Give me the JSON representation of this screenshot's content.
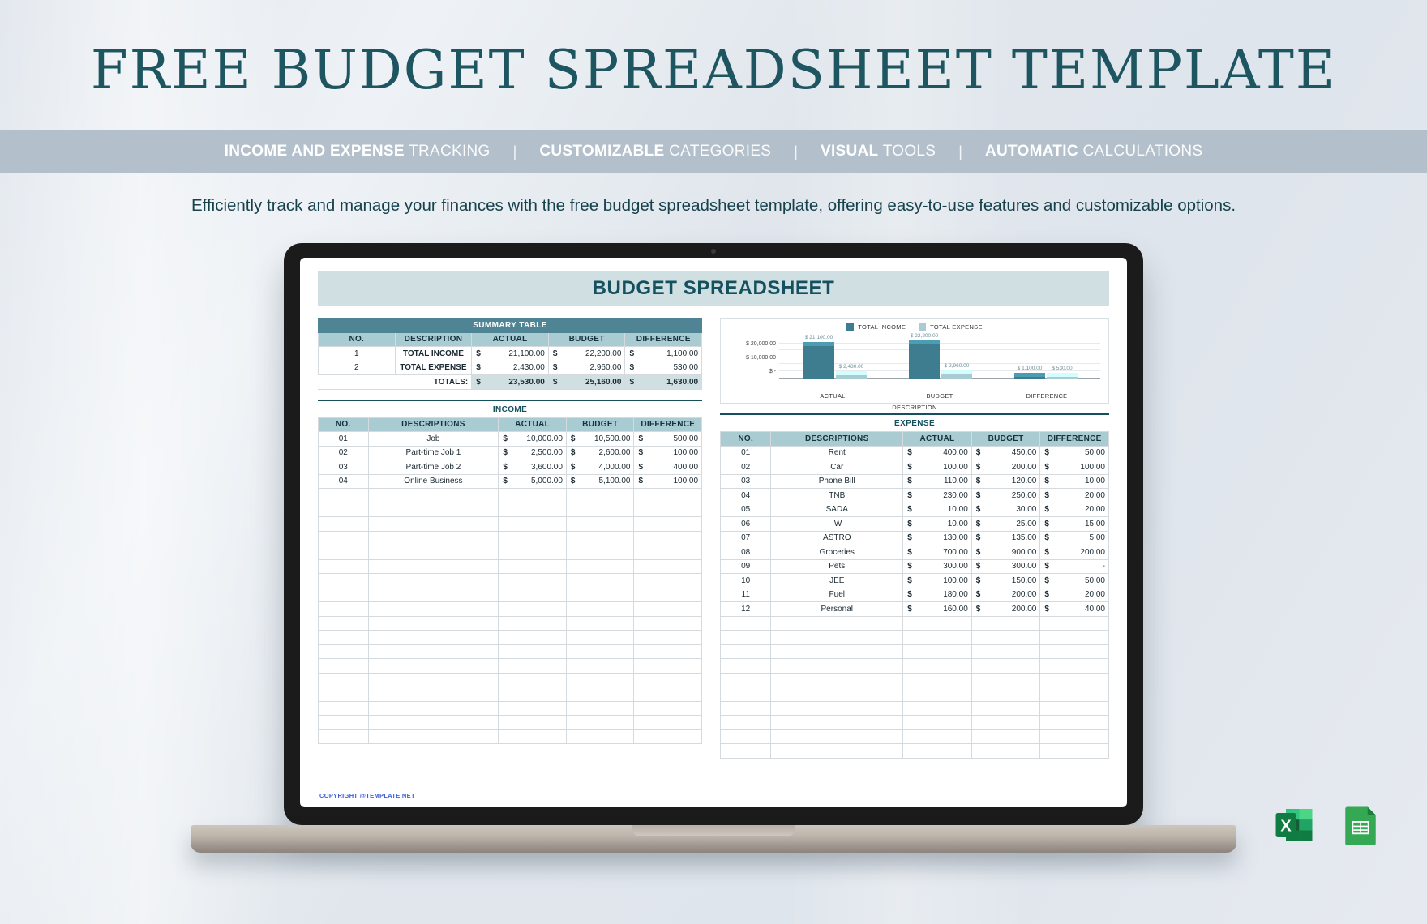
{
  "hero": {
    "title": "FREE BUDGET SPREADSHEET TEMPLATE",
    "subtitle": "Efficiently track and manage your finances with the free budget spreadsheet template, offering easy-to-use features and customizable options.",
    "features": [
      {
        "bold": "INCOME AND EXPENSE",
        "rest": " TRACKING"
      },
      {
        "bold": "CUSTOMIZABLE",
        "rest": " CATEGORIES"
      },
      {
        "bold": "VISUAL",
        "rest": " TOOLS"
      },
      {
        "bold": "AUTOMATIC",
        "rest": " CALCULATIONS"
      }
    ],
    "separator": "|"
  },
  "colors": {
    "teal_dark": "#14505e",
    "teal_header": "#4e8494",
    "teal_light": "#a9cbd2",
    "teal_pale": "#cfdfe2",
    "feature_bar": "#b3c0cb",
    "link_blue": "#3b5bdb",
    "excel_green": "#217346",
    "sheets_green": "#0f9d58"
  },
  "sheet": {
    "title": "BUDGET SPREADSHEET",
    "copyright": "COPYRIGHT @TEMPLATE.NET",
    "summary": {
      "band_title": "SUMMARY TABLE",
      "headers": [
        "NO.",
        "DESCRIPTION",
        "ACTUAL",
        "BUDGET",
        "DIFFERENCE"
      ],
      "rows": [
        {
          "no": "1",
          "desc": "TOTAL INCOME",
          "actual": "21,100.00",
          "budget": "22,200.00",
          "difference": "1,100.00"
        },
        {
          "no": "2",
          "desc": "TOTAL EXPENSE",
          "actual": "2,430.00",
          "budget": "2,960.00",
          "difference": "530.00"
        }
      ],
      "totals_label": "TOTALS:",
      "totals": {
        "actual": "23,530.00",
        "budget": "25,160.00",
        "difference": "1,630.00"
      },
      "currency": "$"
    },
    "income": {
      "section_label": "INCOME",
      "headers": [
        "NO.",
        "DESCRIPTIONS",
        "ACTUAL",
        "BUDGET",
        "DIFFERENCE"
      ],
      "rows": [
        {
          "no": "01",
          "desc": "Job",
          "actual": "10,000.00",
          "budget": "10,500.00",
          "difference": "500.00"
        },
        {
          "no": "02",
          "desc": "Part-time Job 1",
          "actual": "2,500.00",
          "budget": "2,600.00",
          "difference": "100.00"
        },
        {
          "no": "03",
          "desc": "Part-time Job 2",
          "actual": "3,600.00",
          "budget": "4,000.00",
          "difference": "400.00"
        },
        {
          "no": "04",
          "desc": "Online Business",
          "actual": "5,000.00",
          "budget": "5,100.00",
          "difference": "100.00"
        }
      ],
      "blank_rows": 18,
      "currency": "$"
    },
    "expense": {
      "section_label": "EXPENSE",
      "headers": [
        "NO.",
        "DESCRIPTIONS",
        "ACTUAL",
        "BUDGET",
        "DIFFERENCE"
      ],
      "rows": [
        {
          "no": "01",
          "desc": "Rent",
          "actual": "400.00",
          "budget": "450.00",
          "difference": "50.00"
        },
        {
          "no": "02",
          "desc": "Car",
          "actual": "100.00",
          "budget": "200.00",
          "difference": "100.00"
        },
        {
          "no": "03",
          "desc": "Phone Bill",
          "actual": "110.00",
          "budget": "120.00",
          "difference": "10.00"
        },
        {
          "no": "04",
          "desc": "TNB",
          "actual": "230.00",
          "budget": "250.00",
          "difference": "20.00"
        },
        {
          "no": "05",
          "desc": "SADA",
          "actual": "10.00",
          "budget": "30.00",
          "difference": "20.00"
        },
        {
          "no": "06",
          "desc": "IW",
          "actual": "10.00",
          "budget": "25.00",
          "difference": "15.00"
        },
        {
          "no": "07",
          "desc": "ASTRO",
          "actual": "130.00",
          "budget": "135.00",
          "difference": "5.00"
        },
        {
          "no": "08",
          "desc": "Groceries",
          "actual": "700.00",
          "budget": "900.00",
          "difference": "200.00"
        },
        {
          "no": "09",
          "desc": "Pets",
          "actual": "300.00",
          "budget": "300.00",
          "difference": "-"
        },
        {
          "no": "10",
          "desc": "JEE",
          "actual": "100.00",
          "budget": "150.00",
          "difference": "50.00"
        },
        {
          "no": "11",
          "desc": "Fuel",
          "actual": "180.00",
          "budget": "200.00",
          "difference": "20.00"
        },
        {
          "no": "12",
          "desc": "Personal",
          "actual": "160.00",
          "budget": "200.00",
          "difference": "40.00"
        }
      ],
      "blank_rows": 10,
      "currency": "$"
    }
  },
  "chart_data": {
    "type": "bar",
    "title": "",
    "xlabel": "DESCRIPTION",
    "ylabel": "",
    "categories": [
      "ACTUAL",
      "BUDGET",
      "DIFFERENCE"
    ],
    "series": [
      {
        "name": "TOTAL INCOME",
        "color": "#3d7d8f",
        "values": [
          21100,
          22200,
          1100
        ],
        "labels": [
          "$ 21,100.00",
          "$ 22,200.00",
          "$ 1,100.00"
        ]
      },
      {
        "name": "TOTAL EXPENSE",
        "color": "#a9cbd2",
        "values": [
          2430,
          2960,
          530
        ],
        "labels": [
          "$ 2,430.00",
          "$ 2,960.00",
          "$ 530.00"
        ]
      }
    ],
    "ytick_labels": [
      "$ 20,000.00",
      "$ 10,000.00",
      "$ -"
    ],
    "ylim": [
      0,
      25000
    ],
    "grid": true,
    "legend_position": "top"
  },
  "app_icons": [
    {
      "name": "microsoft-excel-icon",
      "label": "X"
    },
    {
      "name": "google-sheets-icon",
      "label": ""
    }
  ]
}
